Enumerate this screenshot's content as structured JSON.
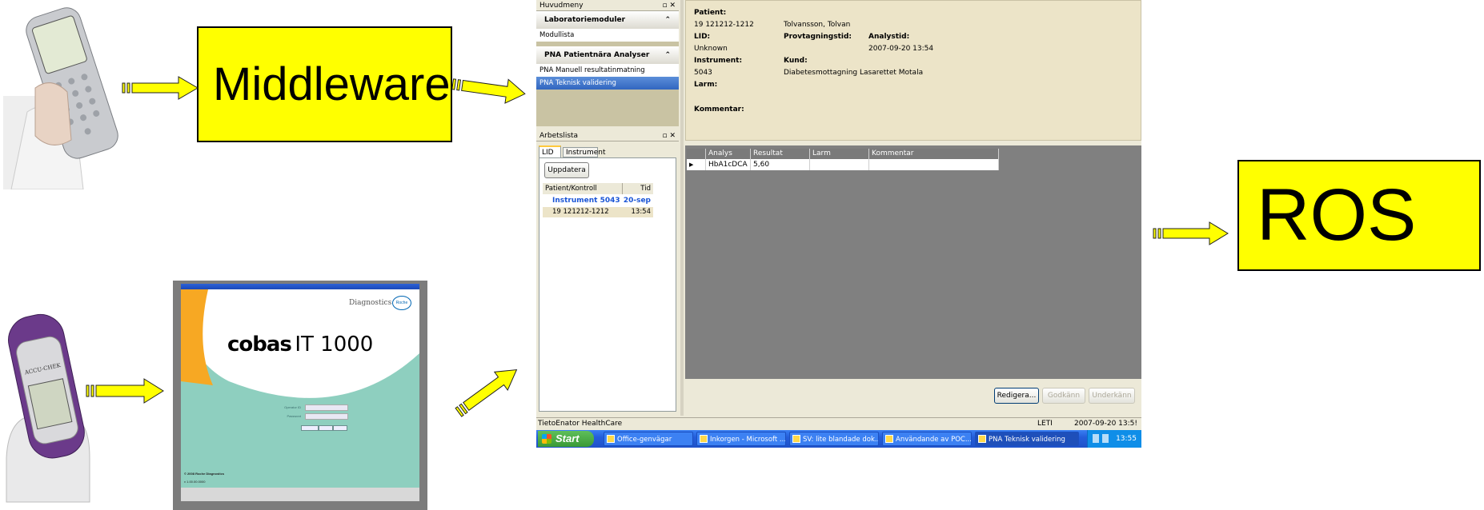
{
  "boxes": {
    "middleware": "Middleware",
    "ros": "ROS"
  },
  "cobas": {
    "brand": "cobas",
    "model": "IT 1000",
    "diagnostics": "Diagnostics",
    "roche": "Roche",
    "field1": "Operator ID",
    "field2": "Password",
    "copyright": "© 2008 Roche Diagnostics",
    "version": "v 1.00.00.0000"
  },
  "photos": {
    "device1": "handheld-analyzer",
    "device2": "accu-chek-inform-device",
    "device2_label": "ACCU-CHEK"
  },
  "app": {
    "nav_panel_title": "Huvudmeny",
    "nav_panel_ctrl": "▫ ✕",
    "groups": [
      {
        "title": "Laboratoriemoduler",
        "items": [
          "Modullista"
        ]
      },
      {
        "title": "PNA Patientnära Analyser",
        "items": [
          "PNA Manuell resultatinmatning",
          "PNA Teknisk validering"
        ]
      }
    ],
    "worklist_title": "Arbetslista",
    "tabs": [
      "LID",
      "Instrument"
    ],
    "update_button": "Uppdatera",
    "worklist_cols": [
      "Patient/Kontroll",
      "Tid"
    ],
    "worklist_rows": [
      {
        "patient": "Instrument 5043",
        "time": "20-sep"
      },
      {
        "patient": "19 121212-1212",
        "time": "13:54"
      }
    ],
    "info": {
      "patient_label": "Patient:",
      "patient_id": "19 121212-1212",
      "patient_name": "Tolvansson, Tolvan",
      "lid_label": "LID:",
      "lid_value": "Unknown",
      "provtagning_label": "Provtagningstid:",
      "analystid_label": "Analystid:",
      "analystid_value": "2007-09-20 13:54",
      "instrument_label": "Instrument:",
      "instrument_value": "5043",
      "kund_label": "Kund:",
      "kund_value": "Diabetesmottagning Lasarettet Motala",
      "larm_label": "Larm:",
      "kommentar_label": "Kommentar:"
    },
    "grid": {
      "headers": [
        "Analys",
        "Resultat",
        "Larm",
        "Kommentar"
      ],
      "rows": [
        [
          "HbA1cDCA",
          "5,60",
          "",
          ""
        ]
      ]
    },
    "buttons": {
      "edit": "Redigera...",
      "approve": "Godkänn",
      "reject": "Underkänn"
    },
    "status": {
      "company": "TietoEnator HealthCare",
      "user": "LETI",
      "datetime": "2007-09-20 13:5!"
    },
    "taskbar": {
      "start": "Start",
      "tasks": [
        "Office-genvägar",
        "Inkorgen - Microsoft ...",
        "SV: lite blandade dok...",
        "Användande av POC...",
        "PNA Teknisk validering"
      ],
      "clock": "13:55"
    }
  },
  "colors": {
    "box_fill": "#ffff00",
    "arrow_fill": "#ffff00",
    "selection": "#316ac5"
  }
}
